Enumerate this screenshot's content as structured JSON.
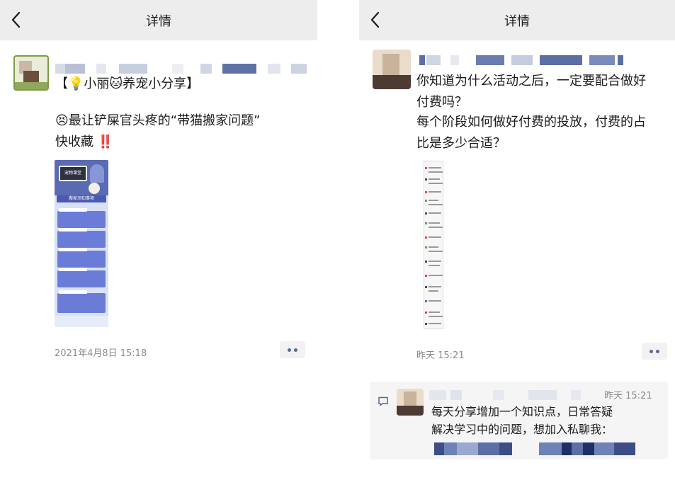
{
  "left": {
    "nav": {
      "title": "详情"
    },
    "post": {
      "line1": "【💡小丽🐱养宠小分享】",
      "line2": "😣最让铲屎官头疼的“带猫搬家问题”",
      "line3": "快收藏 ‼️",
      "image_title": "宠物课堂",
      "image_banner": "搬家须知事项",
      "time": "2021年4月8日 15:18"
    }
  },
  "right": {
    "nav": {
      "title": "详情"
    },
    "post": {
      "lines": [
        "你知道为什么活动之后，一定要配合做好",
        "付费吗？",
        "每个阶段如何做好付费的投放，付费的占",
        "比是多少合适？"
      ],
      "time": "昨天 15:21"
    },
    "comment": {
      "time": "昨天 15:21",
      "line1": "每天分享增加一个知识点，日常答疑",
      "line2": "解决学习中的问题，想加入私聊我："
    }
  },
  "colors": {
    "nav_bg": "#ededed",
    "link_blue": "#576b95",
    "meta_gray": "#8c8c8c",
    "comment_bg": "#f5f5f5"
  },
  "icons": {
    "back": "chevron-left-icon",
    "more": "more-dots-icon",
    "comment": "comment-icon"
  }
}
